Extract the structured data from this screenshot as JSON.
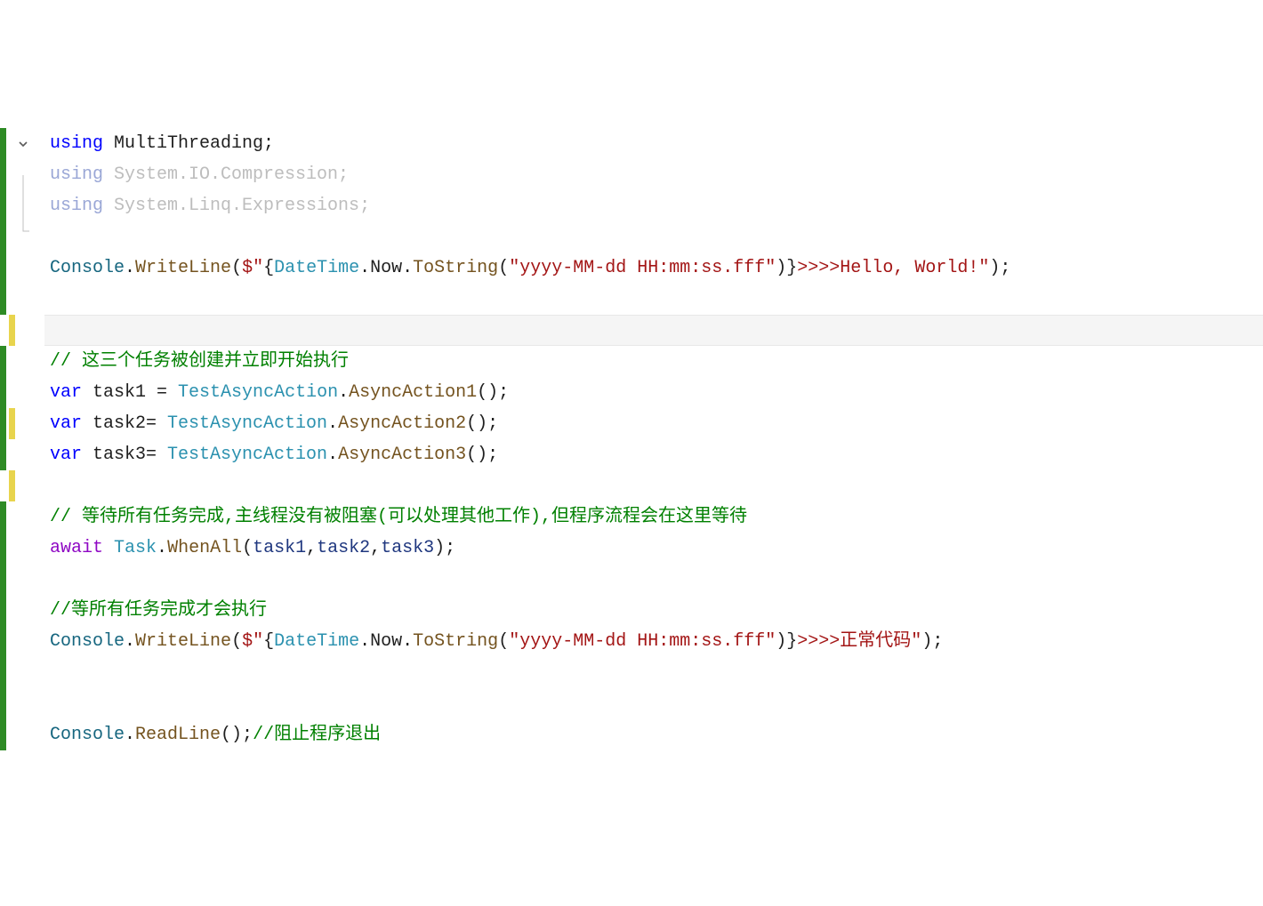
{
  "lines": {
    "l1": {
      "kw": "using",
      "ns": " MultiThreading;"
    },
    "l2": {
      "kw": "using",
      "ns": " System.IO.Compression;"
    },
    "l3": {
      "kw": "using",
      "ns": " System.Linq.Expressions;"
    },
    "l5": {
      "first": "Console",
      "dot1": ".",
      "method": "WriteLine",
      "open": "(",
      "dollar": "$\"",
      "lb": "{",
      "dt": "DateTime",
      "dot2": ".",
      "now": "Now",
      "dot3": ".",
      "tostr": "ToString",
      "op2": "(",
      "fmt": "\"yyyy-MM-dd HH:mm:ss.fff\"",
      "cl2": ")",
      "rb": "}",
      "rest": ">>>>Hello, World!\"",
      "end": ");"
    },
    "l8": {
      "comment": "// 这三个任务被创建并立即开始执行"
    },
    "l9": {
      "kw": "var",
      "name": " task1 = ",
      "cls": "TestAsyncAction",
      "dot": ".",
      "method": "AsyncAction1",
      "end": "();"
    },
    "l10": {
      "kw": "var",
      "name": " task2= ",
      "cls": "TestAsyncAction",
      "dot": ".",
      "method": "AsyncAction2",
      "end": "();"
    },
    "l11": {
      "kw": "var",
      "name": " task3= ",
      "cls": "TestAsyncAction",
      "dot": ".",
      "method": "AsyncAction3",
      "end": "();"
    },
    "l13": {
      "comment": "// 等待所有任务完成,主线程没有被阻塞(可以处理其他工作),但程序流程会在这里等待"
    },
    "l14": {
      "kw": "await",
      "sp": " ",
      "cls": "Task",
      "dot": ".",
      "method": "WhenAll",
      "open": "(",
      "a1": "task1",
      "c1": ",",
      "a2": "task2",
      "c2": ",",
      "a3": "task3",
      "end": ");"
    },
    "l16": {
      "comment": "//等所有任务完成才会执行"
    },
    "l17": {
      "first": "Console",
      "dot1": ".",
      "method": "WriteLine",
      "open": "(",
      "dollar": "$\"",
      "lb": "{",
      "dt": "DateTime",
      "dot2": ".",
      "now": "Now",
      "dot3": ".",
      "tostr": "ToString",
      "op2": "(",
      "fmt": "\"yyyy-MM-dd HH:mm:ss.fff\"",
      "cl2": ")",
      "rb": "}",
      "rest": ">>>>正常代码\"",
      "end": ");"
    },
    "l20": {
      "first": "Console",
      "dot1": ".",
      "method": "ReadLine",
      "end": "();",
      "comment": "//阻止程序退出"
    }
  }
}
